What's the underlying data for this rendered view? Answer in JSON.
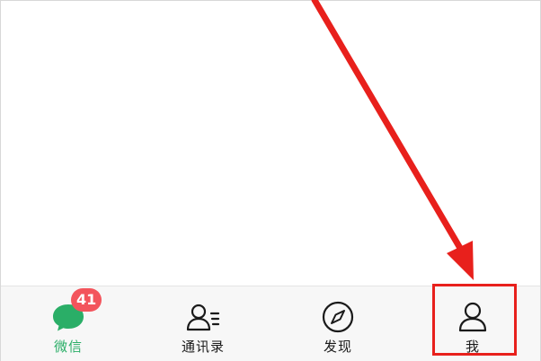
{
  "tabbar": {
    "tabs": [
      {
        "label": "微信",
        "icon": "chat-bubble-icon",
        "active": true,
        "badge": "41"
      },
      {
        "label": "通讯录",
        "icon": "contacts-icon",
        "active": false
      },
      {
        "label": "发现",
        "icon": "compass-icon",
        "active": false
      },
      {
        "label": "我",
        "icon": "person-icon",
        "active": false
      }
    ]
  },
  "colors": {
    "accent": "#2aae67",
    "badge": "#f3545c",
    "annotation": "#e8201c",
    "tabbar_bg": "#f7f7f7"
  }
}
